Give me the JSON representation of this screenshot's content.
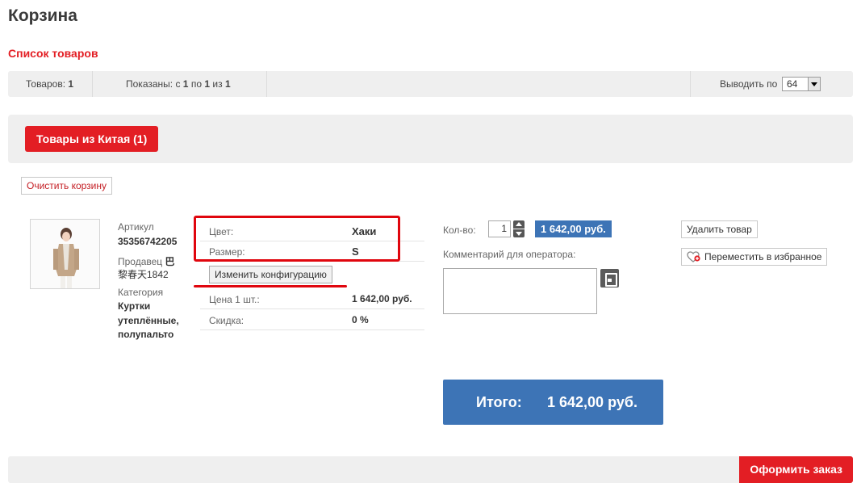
{
  "page": {
    "title": "Корзина",
    "list_title": "Список товаров"
  },
  "pager": {
    "items_label": "Товаров:",
    "items_count": "1",
    "shown_label": "Показаны: с",
    "shown_from": "1",
    "shown_mid": "по",
    "shown_to": "1",
    "shown_of_label": "из",
    "shown_total": "1",
    "per_page_label": "Выводить по",
    "per_page_value": "64"
  },
  "tabs": [
    {
      "label": "Товары из Китая (1)",
      "active": true
    }
  ],
  "clear_cart_label": "Очистить корзину",
  "item": {
    "article_label": "Артикул",
    "article_value": "35356742205",
    "seller_label": "Продавец",
    "seller_value_line1": "巴",
    "seller_value_line2": "黎春天1842",
    "category_label": "Категория",
    "category_lines": [
      "Куртки",
      "утеплённые,",
      "полупальто"
    ],
    "config": [
      {
        "key": "Цвет:",
        "value": "Хаки"
      },
      {
        "key": "Размер:",
        "value": "S"
      }
    ],
    "change_config_label": "Изменить конфигурацию",
    "price_rows": [
      {
        "key": "Цена 1 шт.:",
        "value": "1 642,00 руб."
      },
      {
        "key": "Скидка:",
        "value": "0 %"
      }
    ],
    "qty_label": "Кол-во:",
    "qty_value": "1",
    "line_price": "1 642,00 руб.",
    "comment_label": "Комментарий для оператора:",
    "comment_value": "",
    "remove_label": "Удалить товар",
    "move_fav_label": "Переместить в избранное"
  },
  "total": {
    "label": "Итого:",
    "amount": "1 642,00 руб."
  },
  "checkout_label": "Оформить заказ",
  "colors": {
    "accent_red": "#e31e24",
    "accent_blue": "#3d74b6",
    "bar_gray": "#efefef"
  },
  "icons": {
    "save": "save-icon",
    "favorite": "heart-icon",
    "spin_up": "chevron-up-icon",
    "spin_down": "chevron-down-icon",
    "dropdown": "dropdown-arrow-icon"
  }
}
